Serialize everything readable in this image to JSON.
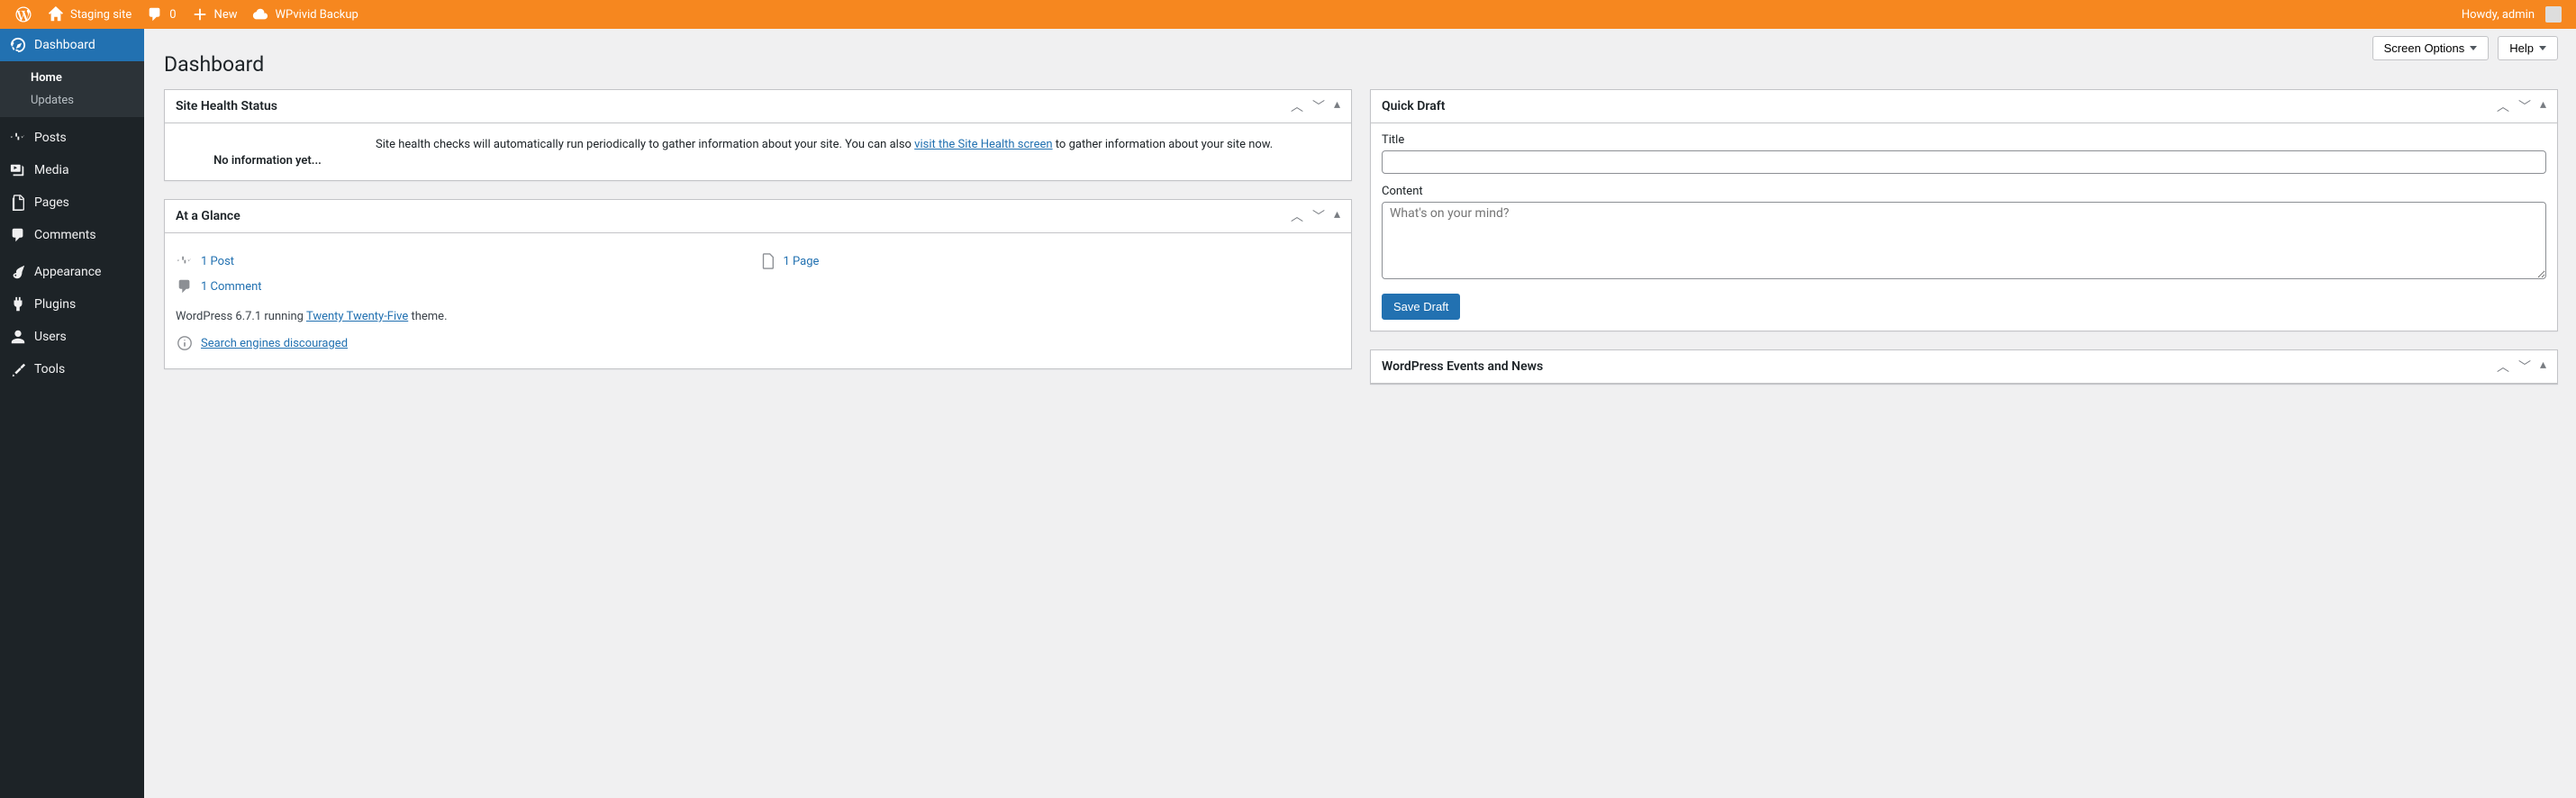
{
  "adminbar": {
    "site_name": "Staging site",
    "comments_count": "0",
    "new_label": "New",
    "wpvivid_label": "WPvivid Backup",
    "howdy": "Howdy, admin"
  },
  "menu": {
    "dashboard": "Dashboard",
    "home": "Home",
    "updates": "Updates",
    "posts": "Posts",
    "media": "Media",
    "pages": "Pages",
    "comments": "Comments",
    "appearance": "Appearance",
    "plugins": "Plugins",
    "users": "Users",
    "tools": "Tools"
  },
  "screen_meta": {
    "screen_options": "Screen Options",
    "help": "Help"
  },
  "page_title": "Dashboard",
  "site_health": {
    "title": "Site Health Status",
    "no_info": "No information yet...",
    "text_before": "Site health checks will automatically run periodically to gather information about your site. You can also ",
    "link": "visit the Site Health screen",
    "text_after": " to gather information about your site now."
  },
  "glance": {
    "title": "At a Glance",
    "posts": "1 Post",
    "pages": "1 Page",
    "comments": "1 Comment",
    "running_before": "WordPress 6.7.1 running ",
    "theme": "Twenty Twenty-Five",
    "running_after": " theme.",
    "search": "Search engines discouraged"
  },
  "quick_draft": {
    "title": "Quick Draft",
    "title_label": "Title",
    "content_label": "Content",
    "content_placeholder": "What's on your mind?",
    "save": "Save Draft"
  },
  "events": {
    "title": "WordPress Events and News"
  }
}
